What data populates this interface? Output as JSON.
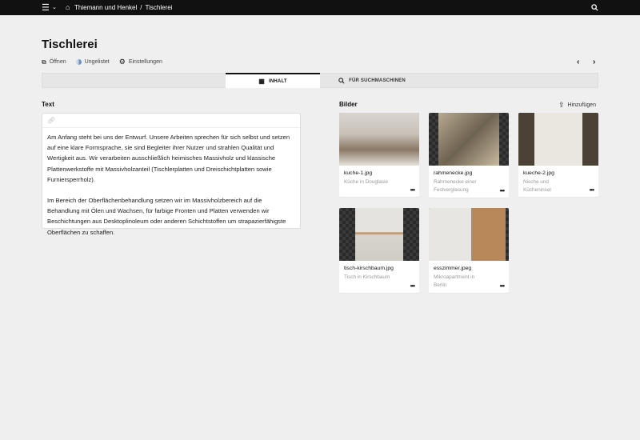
{
  "topbar": {
    "breadcrumb_site": "Thiemann und Henkel",
    "breadcrumb_sep": "/",
    "breadcrumb_page": "Tischlerei"
  },
  "page": {
    "title": "Tischlerei"
  },
  "toolbar": {
    "open": "Öffnen",
    "status": "Ungelistet",
    "settings": "Einstellungen"
  },
  "tabs": [
    {
      "label": "INHALT"
    },
    {
      "label": "FÜR SUCHMASCHINEN"
    }
  ],
  "text_section": {
    "label": "Text",
    "paragraphs": [
      "Am Anfang steht bei uns der Entwurf. Unsere Arbeiten sprechen für sich selbst und setzen auf eine klare Formsprache, sie sind Begleiter ihrer Nutzer und strahlen Qualität und Wertigkeit aus. Wir verarbeiten ausschließlich heimisches Massivholz und klassische Plattenwerkstoffe mit Massivholzanteil (Tischlerplatten und Dreischichtplatten sowie Furniersperrholz).",
      "Im Bereich der Oberflächenbehandlung setzen wir im Massivholzbereich auf die Behandlung mit Ölen und Wachsen, für farbige Fronten und Platten verwenden wir Beschichtungen aus Desktoplinoleum oder anderen Schichtstoffen um strapazierfähigste Oberflächen zu schaffen."
    ]
  },
  "images_section": {
    "label": "Bilder",
    "add": "Hinzufügen",
    "items": [
      {
        "file": "kuche-1.jpg",
        "caption": "Küche in Douglasie"
      },
      {
        "file": "rahmenecke.jpg",
        "caption": "Rahmenecke einer Festverglasung"
      },
      {
        "file": "kueche-2.jpg",
        "caption": "Nische und Kücheninsel"
      },
      {
        "file": "tisch-kirschbaum.jpg",
        "caption": "Tisch in Kirschbaum"
      },
      {
        "file": "esszimmer.jpeg",
        "caption": "Mikroapartment in Berlin"
      }
    ]
  }
}
